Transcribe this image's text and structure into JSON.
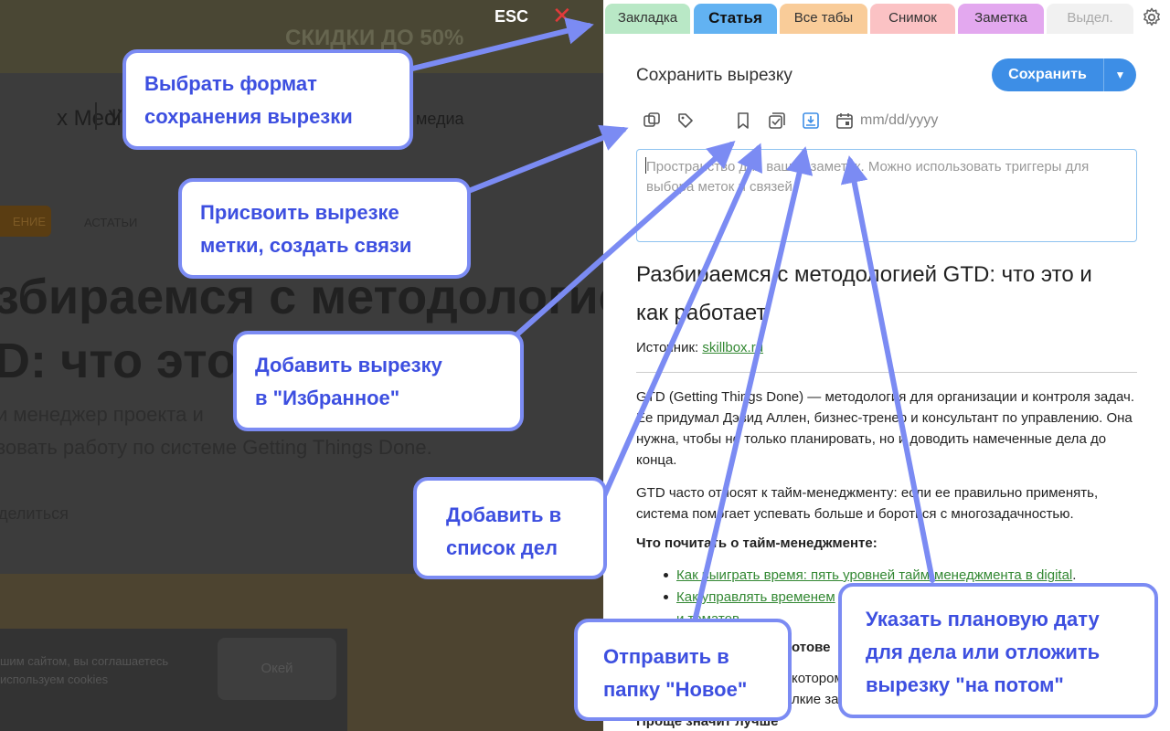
{
  "background": {
    "promo": "СКИДКИ ДО 50%",
    "brand": "x Media",
    "brand_u": "У",
    "brand_media": "о медиа",
    "tag1": "ЕНИЕ",
    "tag2": "АСТАТЬИ",
    "heading_line1": "збираемся с методологией",
    "heading_line2": "D: что это                 ет",
    "lead_line1": "и менеджер проекта и                                 обуйте",
    "lead_line2": "зовать работу по системе Getting Things Done.",
    "share": "делиться",
    "cookie_line1": "шим сайтом, вы соглашаетесь",
    "cookie_line2": "используем cookies",
    "ok": "Окей"
  },
  "overlay": {
    "esc": "ESC"
  },
  "tabs": [
    {
      "label": "Закладка"
    },
    {
      "label": "Статья"
    },
    {
      "label": "Все табы"
    },
    {
      "label": "Снимок"
    },
    {
      "label": "Заметка"
    },
    {
      "label": "Выдел."
    }
  ],
  "panel": {
    "title": "Сохранить вырезку",
    "save_label": "Сохранить",
    "date_placeholder": "mm/dd/yyyy",
    "note_placeholder": "Пространство для ваших заметок. Можно использовать триггеры для выбора меток и связей.",
    "article_title": "Разбираемся с методологией GTD: что это и как работает",
    "source_label": "Источник:",
    "source_link": "skillbox.ru",
    "para1": "GTD (Getting Things Done) — методология для организации и контроля задач. Ее придумал Дэвид Аллен, бизнес-тренер и консультант по управлению. Она нужна, чтобы не только планировать, но и доводить намеченные дела до конца.",
    "para2": "GTD часто относят к тайм-менеджменту: если ее правильно применять, система помогает успевать больше и бороться с многозадачностью.",
    "subhead": "Что почитать о тайм-менеджменте:",
    "list1": "Как выиграть время: пять уровней тайм-менеджмента в digital",
    "list1_end": ".",
    "list2": "Как управлять временем",
    "list2_tail": "и томатов",
    "frag1": "отове",
    "frag2": "котором",
    "frag3": "лкие за",
    "frag4": "Проще значит лучше"
  },
  "callouts": {
    "format": {
      "line1": "Выбрать формат",
      "line2": "сохранения вырезки"
    },
    "tags": {
      "line1": "Присвоить вырезке",
      "line2": "метки, создать связи"
    },
    "favorite": {
      "line1": "Добавить вырезку",
      "line2": "в \"Избранное\""
    },
    "todo": {
      "line1": "Добавить в",
      "line2": "список дел"
    },
    "new_folder": {
      "line1": "Отправить в",
      "line2": "папку \"Новое\""
    },
    "date": {
      "line1": "Указать плановую дату",
      "line2": "для дела или отложить",
      "line3": "вырезку \"на потом\""
    }
  },
  "colors": {
    "accent": "#3d8ee6",
    "callout_border": "#7b8bf3",
    "callout_text": "#3d4fe0",
    "link": "#338833",
    "close": "#e23a3a"
  }
}
